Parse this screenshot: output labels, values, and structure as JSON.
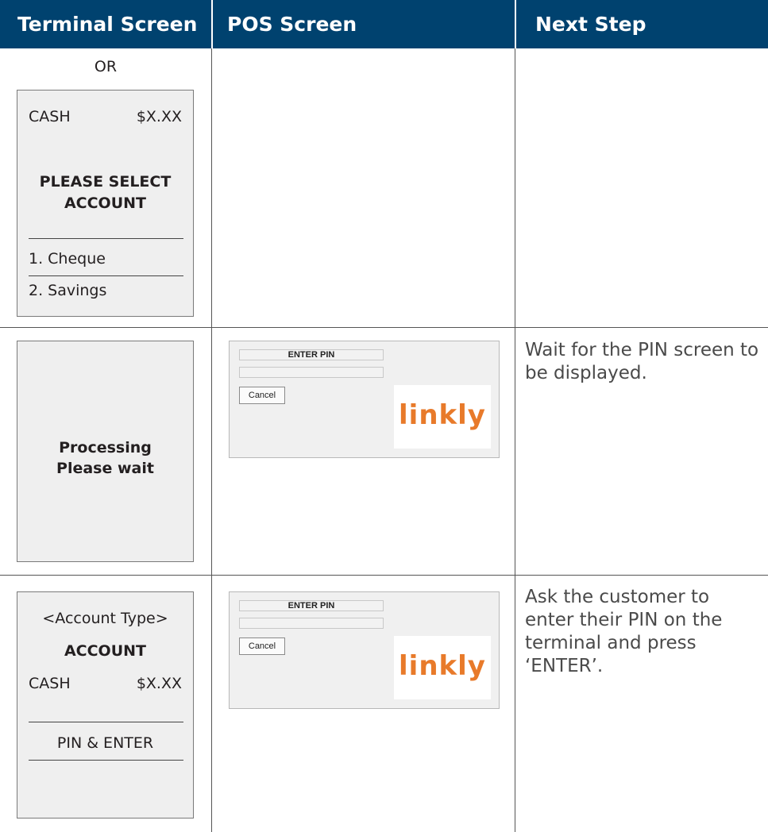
{
  "header": {
    "col1": "Terminal Screen",
    "col2": "POS Screen",
    "col3": "Next Step"
  },
  "row1": {
    "or_label": "OR",
    "terminal": {
      "cash_label": "CASH",
      "amount": "$X.XX",
      "prompt_line1": "PLEASE SELECT",
      "prompt_line2": "ACCOUNT",
      "option1": "1. Cheque",
      "option2": "2. Savings"
    }
  },
  "row2": {
    "terminal": {
      "line1": "Processing",
      "line2": "Please wait"
    },
    "pos": {
      "title": "ENTER PIN",
      "cancel_label": "Cancel",
      "logo_text": "linkly"
    },
    "next_step": "Wait for the PIN screen to be displayed."
  },
  "row3": {
    "terminal": {
      "account_type": "<Account Type>",
      "account_label": "ACCOUNT",
      "cash_label": "CASH",
      "amount": "$X.XX",
      "pin_prompt": "PIN & ENTER"
    },
    "pos": {
      "title": "ENTER PIN",
      "cancel_label": "Cancel",
      "logo_text": "linkly"
    },
    "next_step": "Ask the customer to enter their PIN on the terminal and press ‘ENTER’."
  },
  "colors": {
    "header_bg": "#00426f",
    "logo_orange": "#e87a2a",
    "terminal_bg": "#efefef"
  }
}
